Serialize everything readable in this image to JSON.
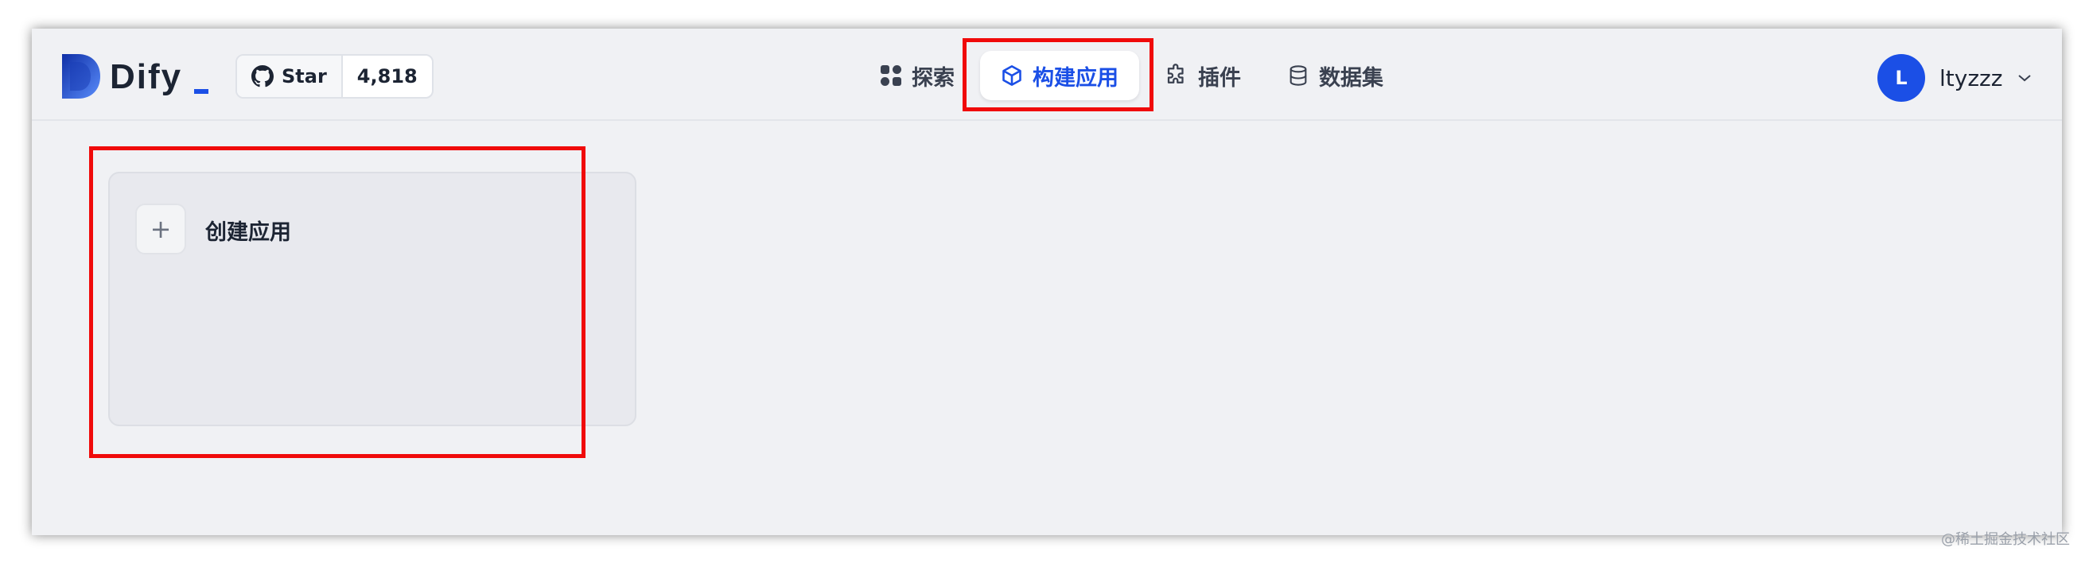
{
  "header": {
    "logo_text": "Dify",
    "github": {
      "star_label": "Star",
      "star_count": "4,818"
    },
    "nav": [
      {
        "label": "探索",
        "icon": "grid-icon",
        "active": false
      },
      {
        "label": "构建应用",
        "icon": "cube-icon",
        "active": true
      },
      {
        "label": "插件",
        "icon": "puzzle-icon",
        "active": false
      },
      {
        "label": "数据集",
        "icon": "database-icon",
        "active": false
      }
    ],
    "user": {
      "avatar_initial": "L",
      "name": "ltyzzz"
    }
  },
  "main": {
    "create_card": {
      "plus": "+",
      "label": "创建应用"
    }
  },
  "watermark": "@稀土掘金技术社区",
  "colors": {
    "accent": "#1b4fe6",
    "background": "#f0f1f4",
    "highlight": "#f00a0a"
  }
}
